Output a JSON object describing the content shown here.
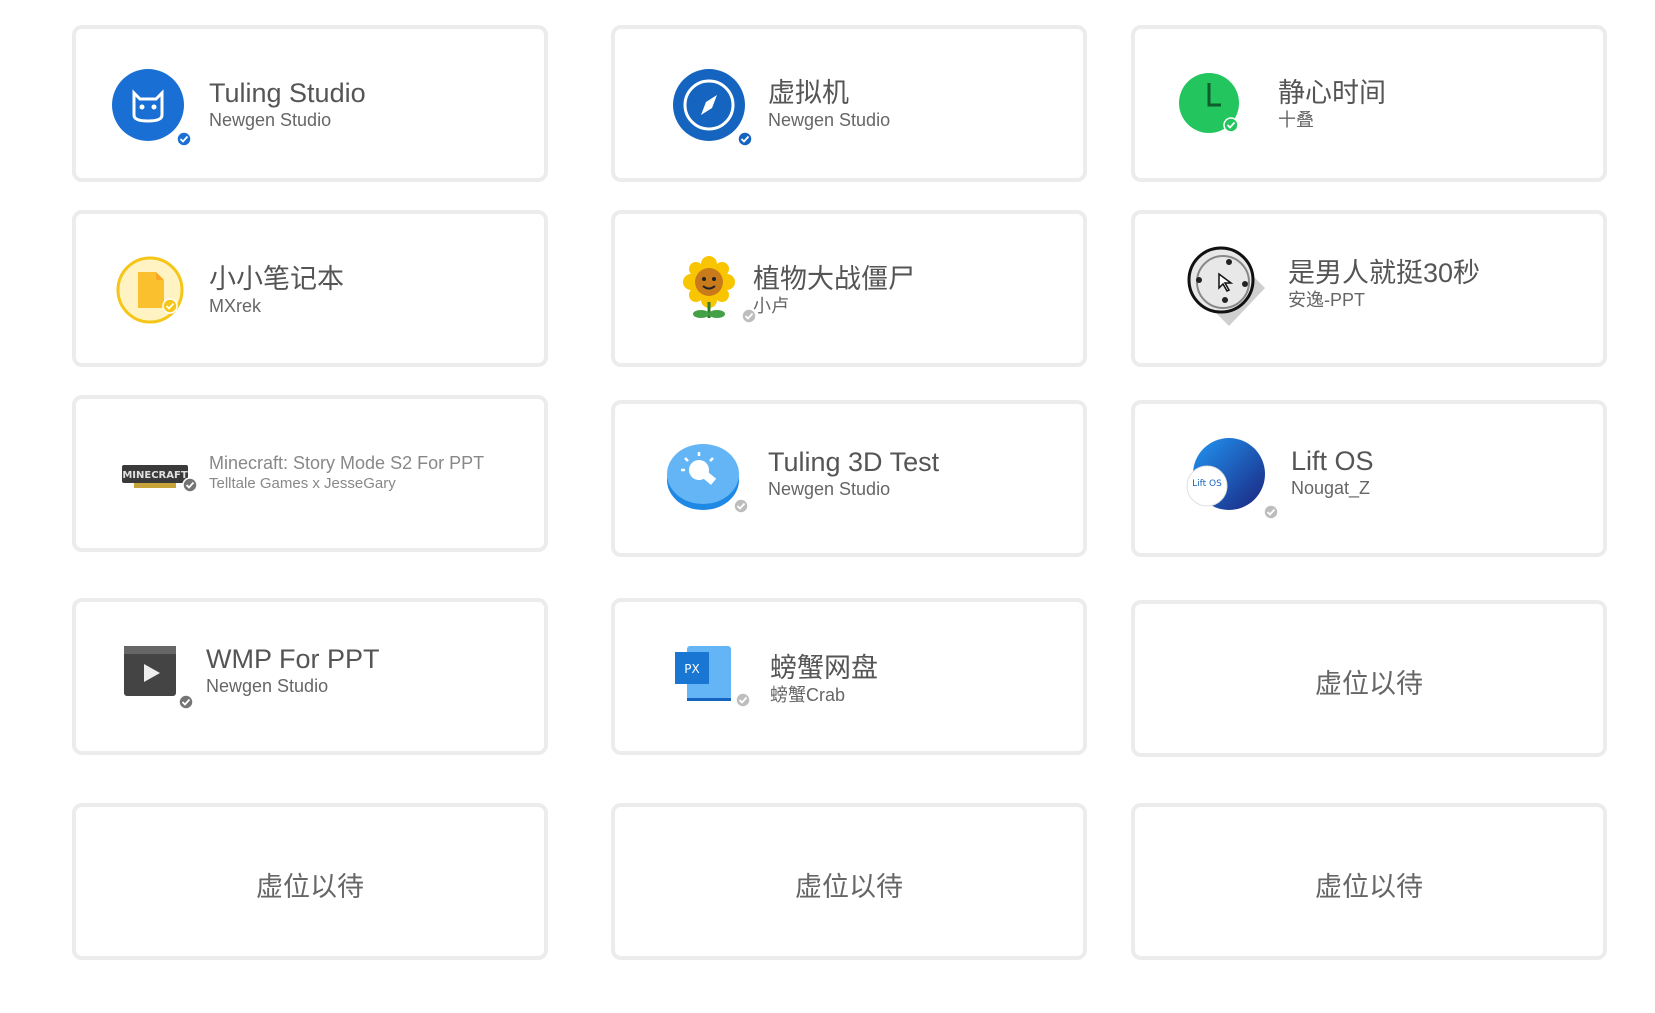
{
  "cards": [
    {
      "title": "Tuling Studio",
      "subtitle": "Newgen Studio",
      "icon": "cat-face-icon"
    },
    {
      "title": "虚拟机",
      "subtitle": "Newgen Studio",
      "icon": "compass-icon"
    },
    {
      "title": "静心时间",
      "subtitle": "十叠",
      "icon": "clock-icon"
    },
    {
      "title": "小小笔记本",
      "subtitle": "MXrek",
      "icon": "notebook-icon"
    },
    {
      "title": "植物大战僵尸",
      "subtitle": "小卢",
      "icon": "sunflower-icon"
    },
    {
      "title": "是男人就挺30秒",
      "subtitle": "安逸-PPT",
      "icon": "target-cursor-icon"
    },
    {
      "title": "Minecraft: Story Mode S2 For PPT",
      "subtitle": "Telltale Games x JesseGary",
      "icon": "minecraft-logo-icon",
      "logo_text": "MINECRAFT"
    },
    {
      "title": "Tuling 3D Test",
      "subtitle": "Newgen Studio",
      "icon": "lightbulb-icon"
    },
    {
      "title": "Lift OS",
      "subtitle": "Nougat_Z",
      "icon": "lift-os-icon",
      "logo_text": "Lift OS"
    },
    {
      "title": "WMP For PPT",
      "subtitle": "Newgen Studio",
      "icon": "media-player-icon"
    },
    {
      "title": "螃蟹网盘",
      "subtitle": "螃蟹Crab",
      "icon": "cloud-drive-icon",
      "logo_text": "PX"
    }
  ],
  "placeholder_label": "虚位以待",
  "colors": {
    "card_border": "#ececec",
    "text": "#555555",
    "badge_blue": "#1976d2",
    "badge_gray": "#9e9e9e"
  }
}
